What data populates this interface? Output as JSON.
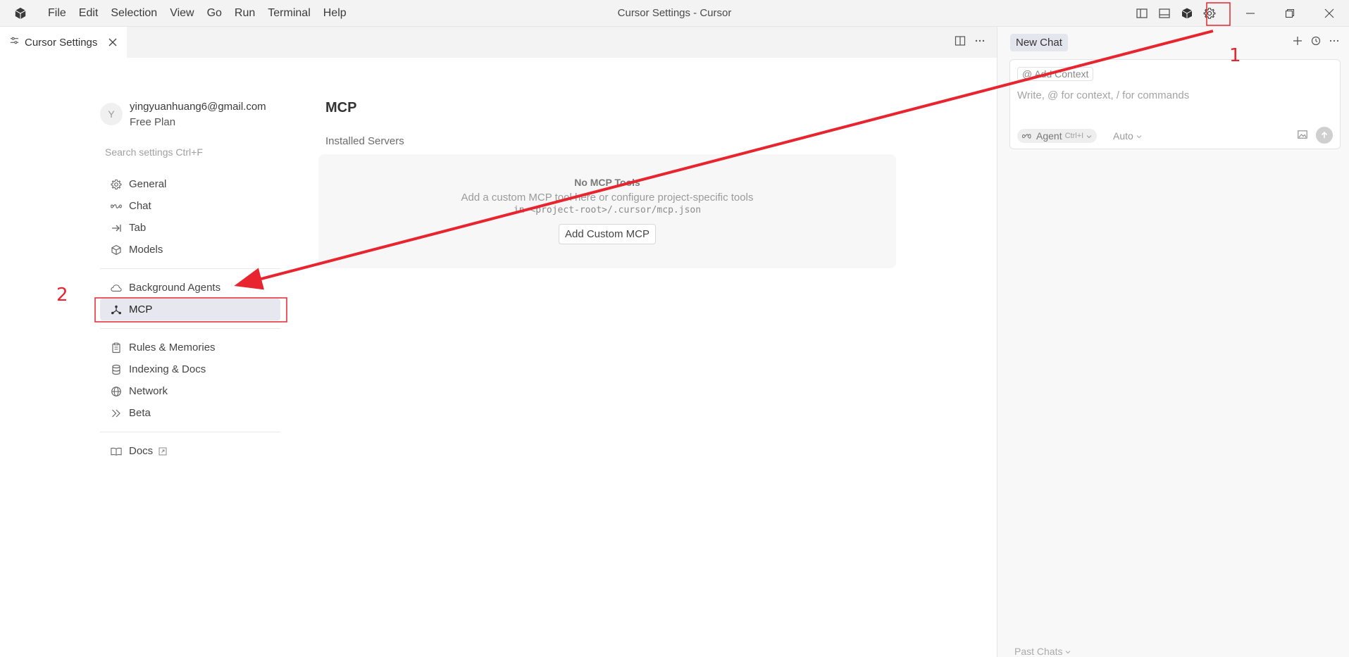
{
  "window": {
    "title": "Cursor Settings - Cursor",
    "menu": [
      "File",
      "Edit",
      "Selection",
      "View",
      "Go",
      "Run",
      "Terminal",
      "Help"
    ]
  },
  "tab": {
    "label": "Cursor Settings"
  },
  "account": {
    "avatar_letter": "Y",
    "email": "yingyuanhuang6@gmail.com",
    "plan": "Free Plan"
  },
  "search": {
    "placeholder": "Search settings Ctrl+F"
  },
  "nav": {
    "group1": [
      {
        "label": "General",
        "icon": "gear-icon"
      },
      {
        "label": "Chat",
        "icon": "infinity-icon"
      },
      {
        "label": "Tab",
        "icon": "tab-arrow-icon"
      },
      {
        "label": "Models",
        "icon": "cube-icon"
      }
    ],
    "group2": [
      {
        "label": "Background Agents",
        "icon": "cloud-icon"
      },
      {
        "label": "MCP",
        "icon": "mcp-nodes-icon",
        "active": true
      }
    ],
    "group3": [
      {
        "label": "Rules & Memories",
        "icon": "clipboard-icon"
      },
      {
        "label": "Indexing & Docs",
        "icon": "database-icon"
      },
      {
        "label": "Network",
        "icon": "globe-icon"
      },
      {
        "label": "Beta",
        "icon": "double-chevron-icon"
      }
    ],
    "group4": [
      {
        "label": "Docs",
        "icon": "book-icon"
      }
    ]
  },
  "main": {
    "title": "MCP",
    "section": "Installed Servers",
    "empty_title": "No MCP Tools",
    "empty_desc": "Add a custom MCP tool here or configure project-specific tools",
    "empty_path": "in <project-root>/.cursor/mcp.json",
    "add_button": "Add Custom MCP"
  },
  "chat": {
    "tab": "New Chat",
    "add_context": "Add Context",
    "placeholder": "Write, @ for context, / for commands",
    "agent_label": "Agent",
    "agent_shortcut": "Ctrl+I",
    "model": "Auto",
    "past_chats": "Past Chats"
  },
  "annotations": {
    "step1": "1",
    "step2": "2",
    "color": "#e8242e"
  },
  "colors": {
    "accent_active_bg": "#e7e7ef",
    "chat_tab_bg": "#e4e6ee"
  }
}
